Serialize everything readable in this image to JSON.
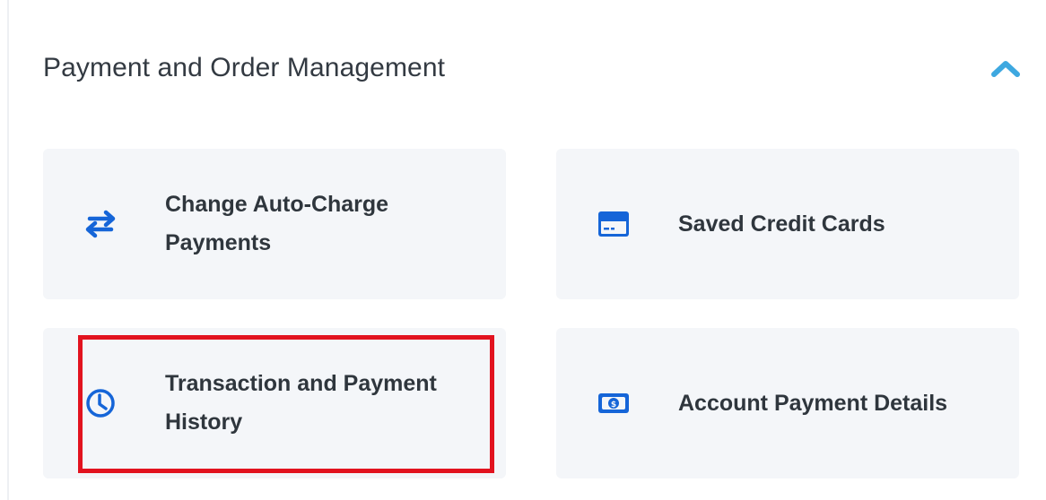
{
  "section": {
    "title": "Payment and Order Management",
    "toggle_icon": "chevron-up-icon"
  },
  "cards": [
    {
      "label": "Change Auto-Charge Payments",
      "icon": "swap-arrows-icon"
    },
    {
      "label": "Saved Credit Cards",
      "icon": "credit-card-icon"
    },
    {
      "label": "Transaction and Payment History",
      "icon": "clock-icon"
    },
    {
      "label": "Account Payment Details",
      "icon": "money-bill-icon"
    }
  ],
  "colors": {
    "accent": "#1565d8",
    "chevron": "#3ea8e0",
    "card_bg": "#f4f6f9",
    "highlight": "#e2131f",
    "text": "#2f363d"
  }
}
